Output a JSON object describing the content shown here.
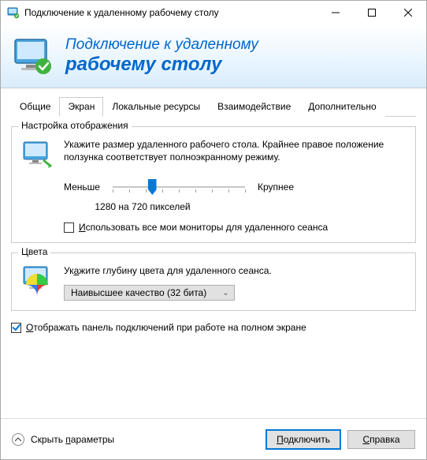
{
  "window": {
    "title": "Подключение к удаленному рабочему столу"
  },
  "banner": {
    "line1": "Подключение к удаленному",
    "line2": "рабочему столу"
  },
  "tabs": {
    "t0": "Общие",
    "t1": "Экран",
    "t2": "Локальные ресурсы",
    "t3": "Взаимодействие",
    "t4": "Дополнительно",
    "active_index": 1
  },
  "display_group": {
    "legend": "Настройка отображения",
    "desc": "Укажите размер удаленного рабочего стола. Крайнее правое положение ползунка соответствует полноэкранному режиму.",
    "slider_min_label": "Меньше",
    "slider_max_label": "Крупнее",
    "resolution_text": "1280 на 720 пикселей",
    "use_all_monitors_label": "Использовать все мои мониторы для удаленного сеанса",
    "use_all_monitors_checked": false,
    "slider_fraction": 0.3
  },
  "colors_group": {
    "legend": "Цвета",
    "desc": "Укажите глубину цвета для удаленного сеанса.",
    "selected": "Наивысшее качество (32 бита)"
  },
  "connection_bar": {
    "label": "Отображать панель подключений при работе на полном экране",
    "checked": true
  },
  "footer": {
    "hide_params": "Скрыть параметры",
    "connect": "Подключить",
    "help": "Справка"
  }
}
